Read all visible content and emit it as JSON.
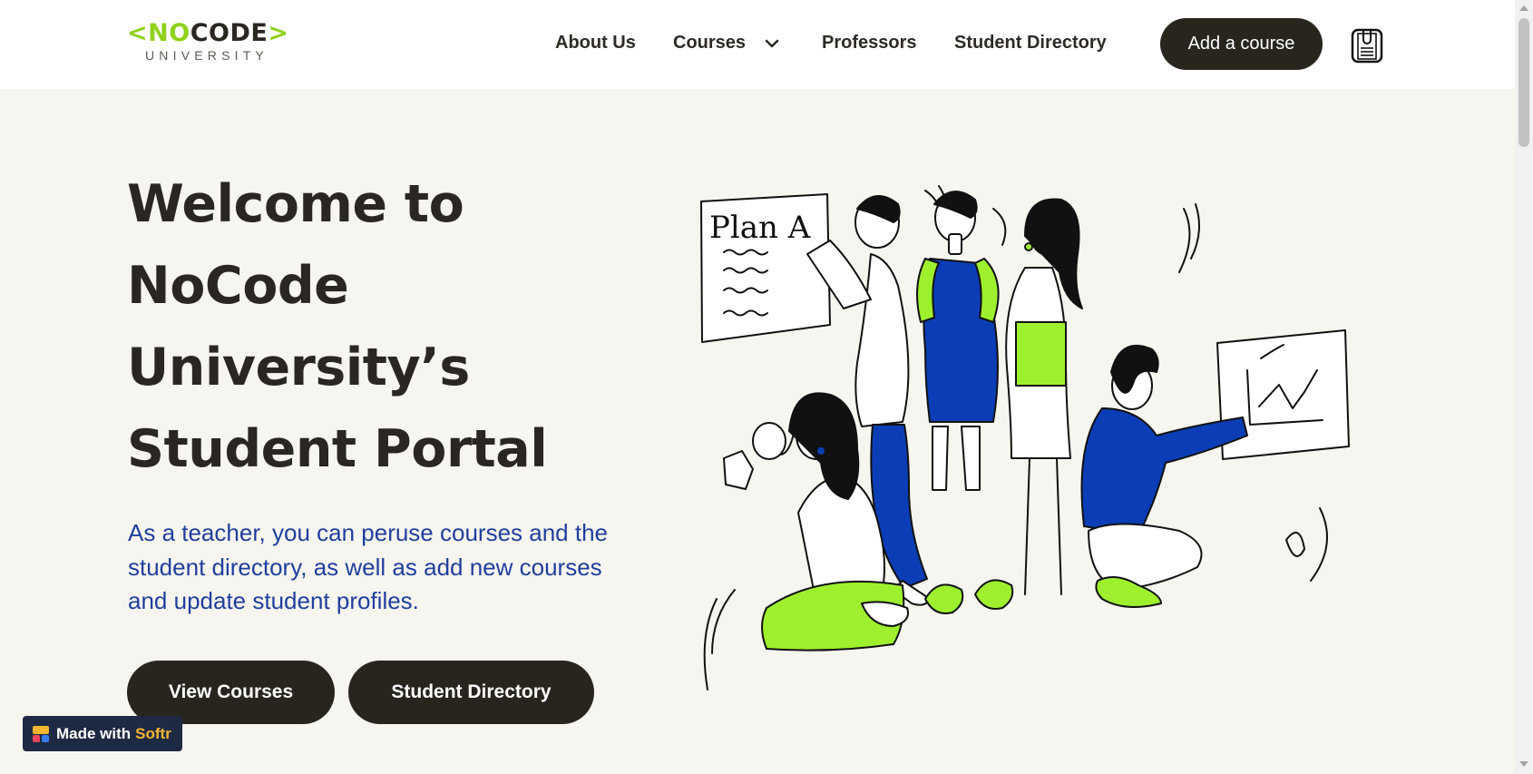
{
  "brand": {
    "logo_open": "<",
    "logo_no": "NO",
    "logo_code": "CODE",
    "logo_close": ">",
    "logo_sub": "UNIVERSITY",
    "accent_color": "#8fd11c"
  },
  "nav": {
    "items": [
      {
        "label": "About Us"
      },
      {
        "label": "Courses",
        "icon": "chevron-down-icon"
      },
      {
        "label": "Professors"
      },
      {
        "label": "Student Directory"
      }
    ],
    "cta_label": "Add a course",
    "profile_icon": "clipboard-icon"
  },
  "hero": {
    "title_lines": [
      "Welcome to",
      "NoCode",
      "University’s",
      "Student Portal"
    ],
    "subtitle": "As a teacher, you can peruse courses and the student directory, as well as add new courses and update student profiles.",
    "buttons": [
      {
        "label": "View Courses"
      },
      {
        "label": "Student Directory"
      }
    ],
    "illustration_text": "Plan A",
    "colors": {
      "dark": "#28251f",
      "blue": "#0b3eb6",
      "green": "#9ef02f",
      "subtitle": "#1f3f9e"
    }
  },
  "badge": {
    "label": "Made with",
    "brand": "Softr"
  }
}
